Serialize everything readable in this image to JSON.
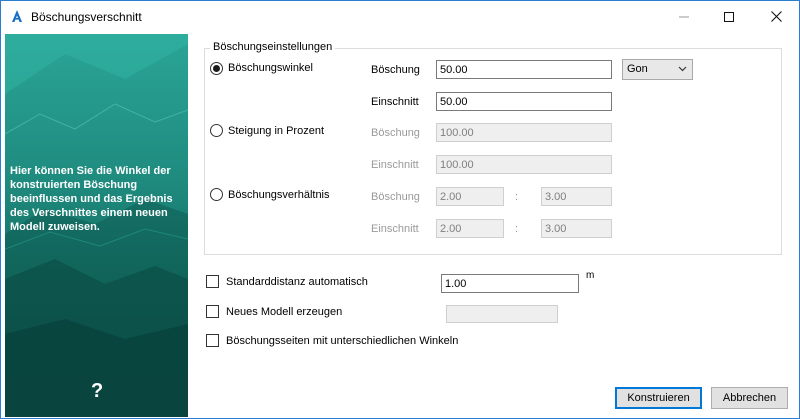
{
  "window": {
    "title": "Böschungsverschnitt"
  },
  "sidebar": {
    "text": "Hier können Sie die Winkel der konstruierten Böschung beeinflussen und das Ergebnis des Verschnittes einem neuen Modell zuweisen.",
    "help_label": "?"
  },
  "group": {
    "title": "Böschungseinstellungen"
  },
  "options": {
    "angle": {
      "label": "Böschungswinkel",
      "selected": true,
      "slope_label": "Böschung",
      "slope_value": "50.00",
      "unit": "Gon",
      "cut_label": "Einschnitt",
      "cut_value": "50.00"
    },
    "percent": {
      "label": "Steigung in Prozent",
      "selected": false,
      "slope_label": "Böschung",
      "slope_value": "100.00",
      "cut_label": "Einschnitt",
      "cut_value": "100.00"
    },
    "ratio": {
      "label": "Böschungsverhältnis",
      "selected": false,
      "slope_label": "Böschung",
      "slope_a": "2.00",
      "slope_b": "3.00",
      "cut_label": "Einschnitt",
      "cut_a": "2.00",
      "cut_b": "3.00",
      "separator": ":"
    }
  },
  "settings": {
    "std_distance": {
      "label": "Standarddistanz automatisch",
      "checked": false,
      "value": "1.00",
      "unit": "m"
    },
    "new_model": {
      "label": "Neues Modell erzeugen",
      "checked": false,
      "value": ""
    },
    "different_angles": {
      "label": "Böschungsseiten mit unterschiedlichen Winkeln",
      "checked": false
    }
  },
  "buttons": {
    "construct": "Konstruieren",
    "cancel": "Abbrechen"
  },
  "colors": {
    "sidebar_teal": "#1f8b7f",
    "accent": "#0078d7"
  }
}
